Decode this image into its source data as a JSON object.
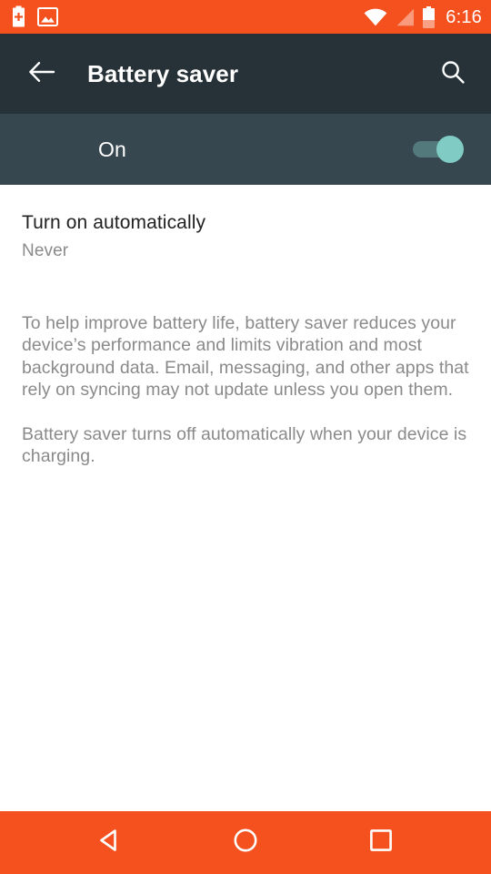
{
  "status_bar": {
    "background_color": "#F4511E",
    "left_icons": [
      {
        "name": "battery-saver-icon",
        "label": "Battery saver active"
      },
      {
        "name": "screenshot-image-icon",
        "label": "Screenshot captured"
      }
    ],
    "right_icons": [
      {
        "name": "wifi-icon",
        "label": "Wi-Fi signal full"
      },
      {
        "name": "cell-signal-icon",
        "label": "Mobile signal"
      },
      {
        "name": "battery-icon",
        "label": "Battery level"
      }
    ],
    "time": "6:16"
  },
  "app_bar": {
    "background_color": "#263238",
    "back_label": "Navigate up",
    "title": "Battery saver",
    "search_label": "Search"
  },
  "switch_bar": {
    "background_color": "#37474F",
    "state_label": "On",
    "switch_on": true,
    "accent_color": "#80CBC4"
  },
  "preference": {
    "title": "Turn on automatically",
    "summary": "Never"
  },
  "description": {
    "paragraphs": [
      "To help improve battery life, battery saver reduces your device’s performance and limits vibration and most background data. Email, messaging, and other apps that rely on syncing may not update unless you open them.",
      "Battery saver turns off automatically when your device is charging."
    ],
    "paragraph_1": "To help improve battery life, battery saver reduces your device’s performance and limits vibration and most background data. Email, messaging, and other apps that rely on syncing may not update unless you open them.",
    "paragraph_2": "Battery saver turns off automatically when your device is charging."
  },
  "nav_bar": {
    "background_color": "#F4511E",
    "buttons": [
      {
        "name": "nav-back-button",
        "label": "Back"
      },
      {
        "name": "nav-home-button",
        "label": "Home"
      },
      {
        "name": "nav-recents-button",
        "label": "Recent apps"
      }
    ]
  }
}
